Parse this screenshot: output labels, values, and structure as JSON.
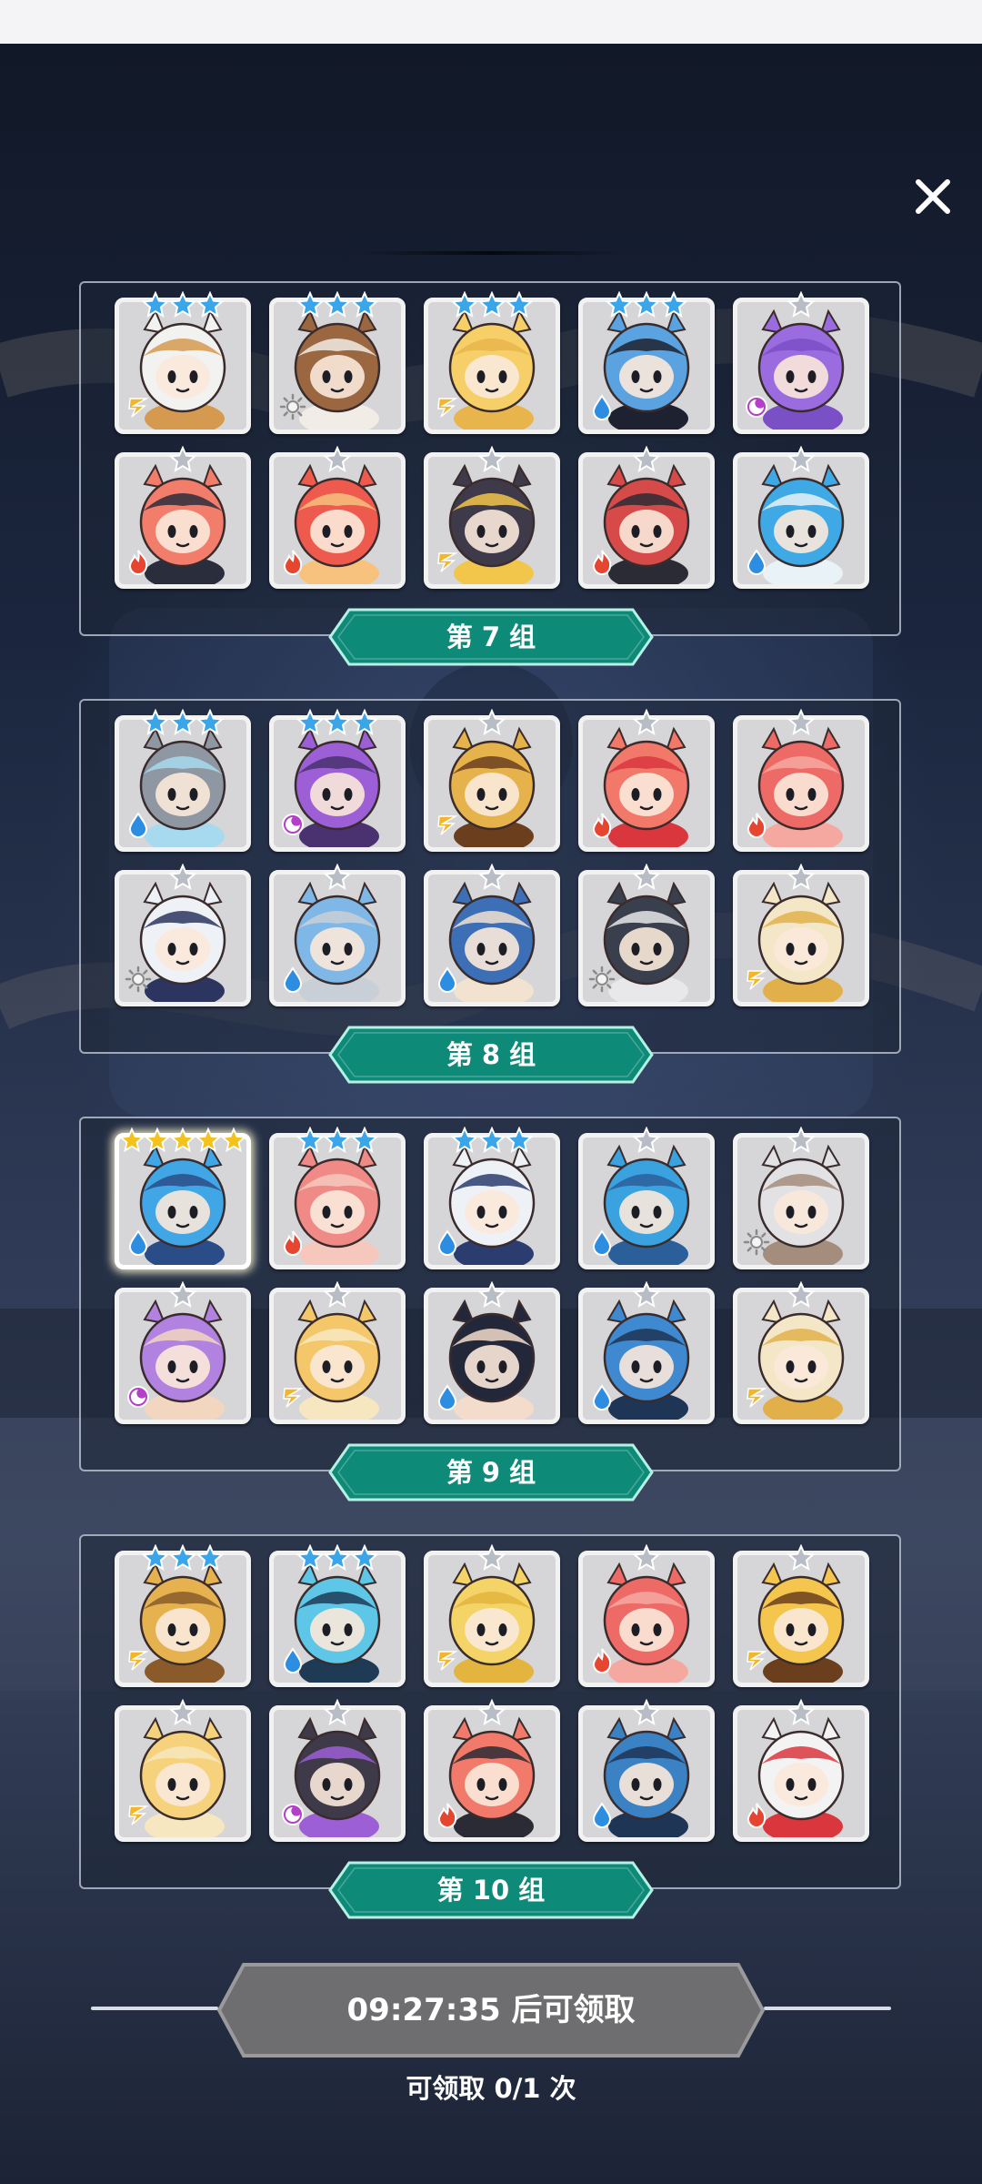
{
  "popup": {
    "close_label": "×"
  },
  "colors": {
    "banner": "#0e8a78",
    "banner_border": "#b5f0e4",
    "panel_border": "#c8d2e1",
    "card_bg": "#d6d6d8",
    "star_blue": "#3aa5e8",
    "star_gold": "#f4c21d",
    "star_silver": "#b8bcc4"
  },
  "groups": [
    {
      "label": "第 7 组",
      "heroes": [
        {
          "stars": 3,
          "star_color": "blue",
          "element": "lightning",
          "hue": "#f2f2f0",
          "accent": "#d59a4f"
        },
        {
          "stars": 3,
          "star_color": "blue",
          "element": "light",
          "hue": "#9a6740",
          "accent": "#f1ece6"
        },
        {
          "stars": 3,
          "star_color": "blue",
          "element": "lightning",
          "hue": "#f6cf68",
          "accent": "#e8b54c"
        },
        {
          "stars": 3,
          "star_color": "blue",
          "element": "water",
          "hue": "#5aa3e0",
          "accent": "#1e2230"
        },
        {
          "stars": 1,
          "star_color": "silver",
          "element": "dark",
          "hue": "#9b6ce0",
          "accent": "#7b4fc5"
        },
        {
          "stars": 1,
          "star_color": "silver",
          "element": "fire",
          "hue": "#f27d6b",
          "accent": "#2a2d3c"
        },
        {
          "stars": 1,
          "star_color": "silver",
          "element": "fire",
          "hue": "#ef5a4e",
          "accent": "#f7c27e"
        },
        {
          "stars": 1,
          "star_color": "silver",
          "element": "lightning",
          "hue": "#3f3a4a",
          "accent": "#f2c64b"
        },
        {
          "stars": 1,
          "star_color": "silver",
          "element": "fire",
          "hue": "#d64a4a",
          "accent": "#2b2b35"
        },
        {
          "stars": 1,
          "star_color": "silver",
          "element": "water",
          "hue": "#3fa9e6",
          "accent": "#e9f2f6"
        }
      ]
    },
    {
      "label": "第 8 组",
      "heroes": [
        {
          "stars": 3,
          "star_color": "blue",
          "element": "water",
          "hue": "#8f97a3",
          "accent": "#a7d9ef"
        },
        {
          "stars": 3,
          "star_color": "blue",
          "element": "dark",
          "hue": "#9c5fd6",
          "accent": "#4a3170"
        },
        {
          "stars": 1,
          "star_color": "silver",
          "element": "lightning",
          "hue": "#e6b24b",
          "accent": "#6b3e1e"
        },
        {
          "stars": 1,
          "star_color": "silver",
          "element": "fire",
          "hue": "#f2786a",
          "accent": "#d9363e"
        },
        {
          "stars": 1,
          "star_color": "silver",
          "element": "fire",
          "hue": "#ee6a66",
          "accent": "#f5a8a0"
        },
        {
          "stars": 1,
          "star_color": "silver",
          "element": "light",
          "hue": "#eef2f6",
          "accent": "#2b3560"
        },
        {
          "stars": 1,
          "star_color": "silver",
          "element": "water",
          "hue": "#7fb8e6",
          "accent": "#c9cfd6"
        },
        {
          "stars": 1,
          "star_color": "silver",
          "element": "water",
          "hue": "#3c6fb5",
          "accent": "#f2e2d0"
        },
        {
          "stars": 1,
          "star_color": "silver",
          "element": "light",
          "hue": "#3a3f4d",
          "accent": "#e8e8ea"
        },
        {
          "stars": 1,
          "star_color": "silver",
          "element": "lightning",
          "hue": "#f3e7c7",
          "accent": "#e2b04a"
        }
      ]
    },
    {
      "label": "第 9 组",
      "heroes": [
        {
          "stars": 5,
          "star_color": "gold",
          "element": "water",
          "hue": "#41a6e6",
          "accent": "#2b4d87",
          "highlight": true
        },
        {
          "stars": 3,
          "star_color": "blue",
          "element": "fire",
          "hue": "#f08a86",
          "accent": "#f6c8bd"
        },
        {
          "stars": 3,
          "star_color": "blue",
          "element": "water",
          "hue": "#eef2f6",
          "accent": "#2b3c6e"
        },
        {
          "stars": 1,
          "star_color": "silver",
          "element": "water",
          "hue": "#3ba2e0",
          "accent": "#2a5f9a"
        },
        {
          "stars": 1,
          "star_color": "silver",
          "element": "light",
          "hue": "#e2e2e4",
          "accent": "#a48d7c"
        },
        {
          "stars": 1,
          "star_color": "silver",
          "element": "dark",
          "hue": "#b282e0",
          "accent": "#f2d6c0"
        },
        {
          "stars": 1,
          "star_color": "silver",
          "element": "lightning",
          "hue": "#f4c86a",
          "accent": "#f7e7c0"
        },
        {
          "stars": 1,
          "star_color": "silver",
          "element": "water",
          "hue": "#23273a",
          "accent": "#f3dccb"
        },
        {
          "stars": 1,
          "star_color": "silver",
          "element": "water",
          "hue": "#3f89d0",
          "accent": "#1f3555"
        },
        {
          "stars": 1,
          "star_color": "silver",
          "element": "lightning",
          "hue": "#f3e7c7",
          "accent": "#e2b04a"
        }
      ]
    },
    {
      "label": "第 10 组",
      "heroes": [
        {
          "stars": 3,
          "star_color": "blue",
          "element": "lightning",
          "hue": "#e5b24f",
          "accent": "#8a5a2a"
        },
        {
          "stars": 3,
          "star_color": "blue",
          "element": "water",
          "hue": "#5ec6e6",
          "accent": "#1f3a55"
        },
        {
          "stars": 1,
          "star_color": "silver",
          "element": "lightning",
          "hue": "#f4d466",
          "accent": "#e3b43e"
        },
        {
          "stars": 1,
          "star_color": "silver",
          "element": "fire",
          "hue": "#ee6a66",
          "accent": "#f5a8a0"
        },
        {
          "stars": 1,
          "star_color": "silver",
          "element": "lightning",
          "hue": "#f4c64e",
          "accent": "#6b3e1e"
        },
        {
          "stars": 1,
          "star_color": "silver",
          "element": "lightning",
          "hue": "#f6d27c",
          "accent": "#f7e7c0"
        },
        {
          "stars": 1,
          "star_color": "silver",
          "element": "dark",
          "hue": "#3f3a4a",
          "accent": "#9c5fd6"
        },
        {
          "stars": 1,
          "star_color": "silver",
          "element": "fire",
          "hue": "#f27a6b",
          "accent": "#2b2b35"
        },
        {
          "stars": 1,
          "star_color": "silver",
          "element": "water",
          "hue": "#3a82c4",
          "accent": "#1f3555"
        },
        {
          "stars": 1,
          "star_color": "silver",
          "element": "fire",
          "hue": "#f3f3f4",
          "accent": "#d9363e"
        }
      ]
    }
  ],
  "claim": {
    "button_label": "09:27:35 后可领取",
    "count_label": "可领取 0/1 次"
  }
}
